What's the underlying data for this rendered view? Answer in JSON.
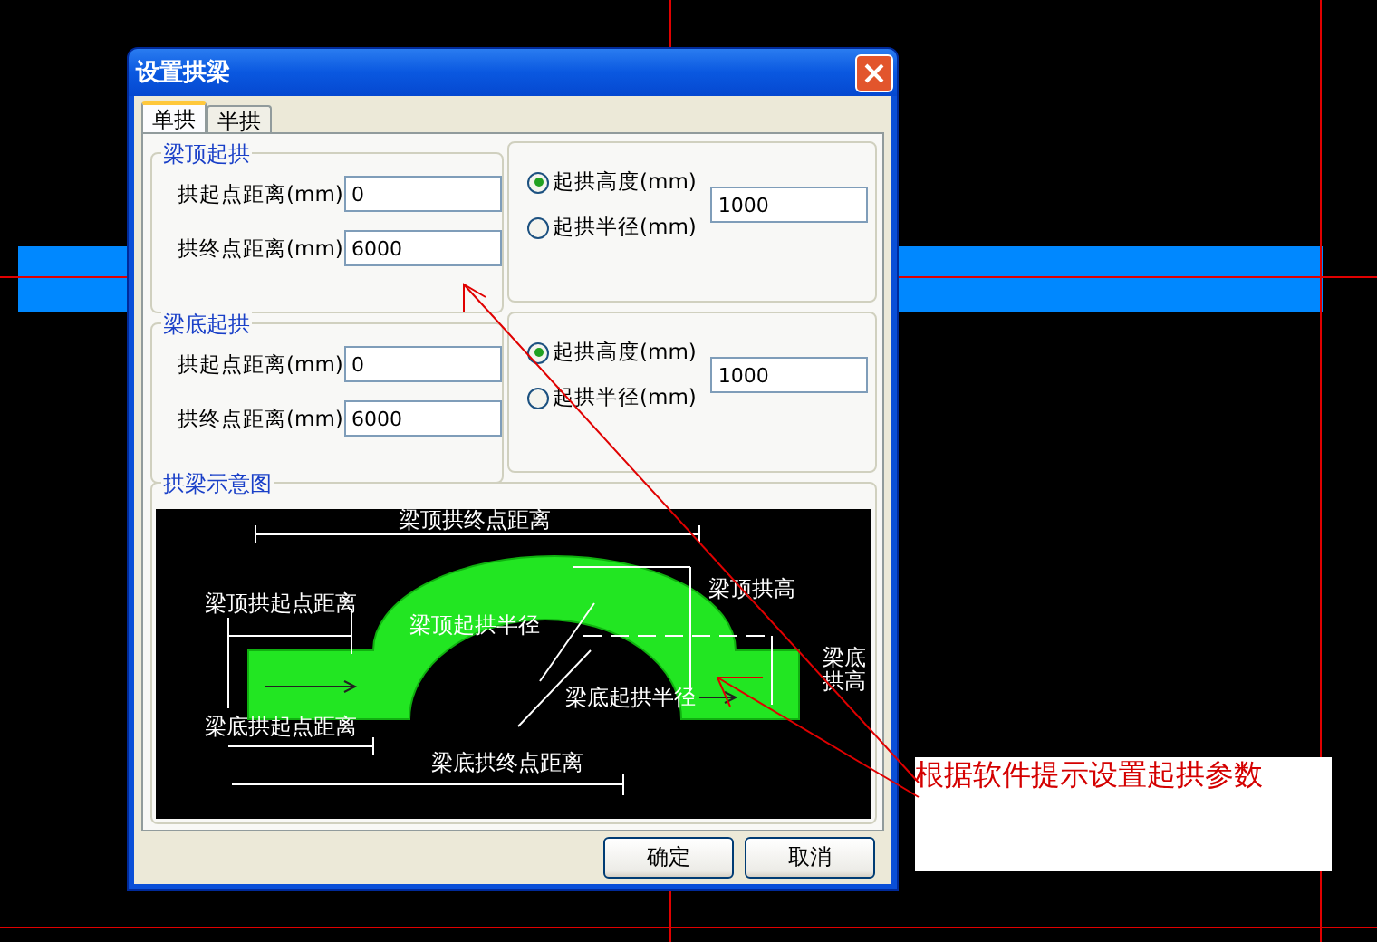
{
  "window": {
    "title": "设置拱梁"
  },
  "tabs": [
    {
      "label": "单拱",
      "selected": true
    },
    {
      "label": "半拱",
      "selected": false
    }
  ],
  "groups": [
    {
      "title": "梁顶起拱",
      "fields": [
        {
          "label": "拱起点距离(mm)",
          "value": "0"
        },
        {
          "label": "拱终点距离(mm)",
          "value": "6000"
        }
      ],
      "options": [
        {
          "label": "起拱高度(mm)",
          "selected": true
        },
        {
          "label": "起拱半径(mm)",
          "selected": false
        }
      ],
      "option_value": "1000"
    },
    {
      "title": "梁底起拱",
      "fields": [
        {
          "label": "拱起点距离(mm)",
          "value": "0"
        },
        {
          "label": "拱终点距离(mm)",
          "value": "6000"
        }
      ],
      "options": [
        {
          "label": "起拱高度(mm)",
          "selected": true
        },
        {
          "label": "起拱半径(mm)",
          "selected": false
        }
      ],
      "option_value": "1000"
    }
  ],
  "diagram": {
    "title": "拱梁示意图",
    "labels": [
      "梁顶拱终点距离",
      "梁顶拱起点距离",
      "梁顶起拱半径",
      "梁顶拱高",
      "梁底拱高",
      "梁底起拱半径",
      "梁底拱起点距离",
      "梁底拱终点距离"
    ]
  },
  "buttons": [
    "确定",
    "取消"
  ],
  "annotation": {
    "text": "根据软件提示设置起拱参数"
  }
}
